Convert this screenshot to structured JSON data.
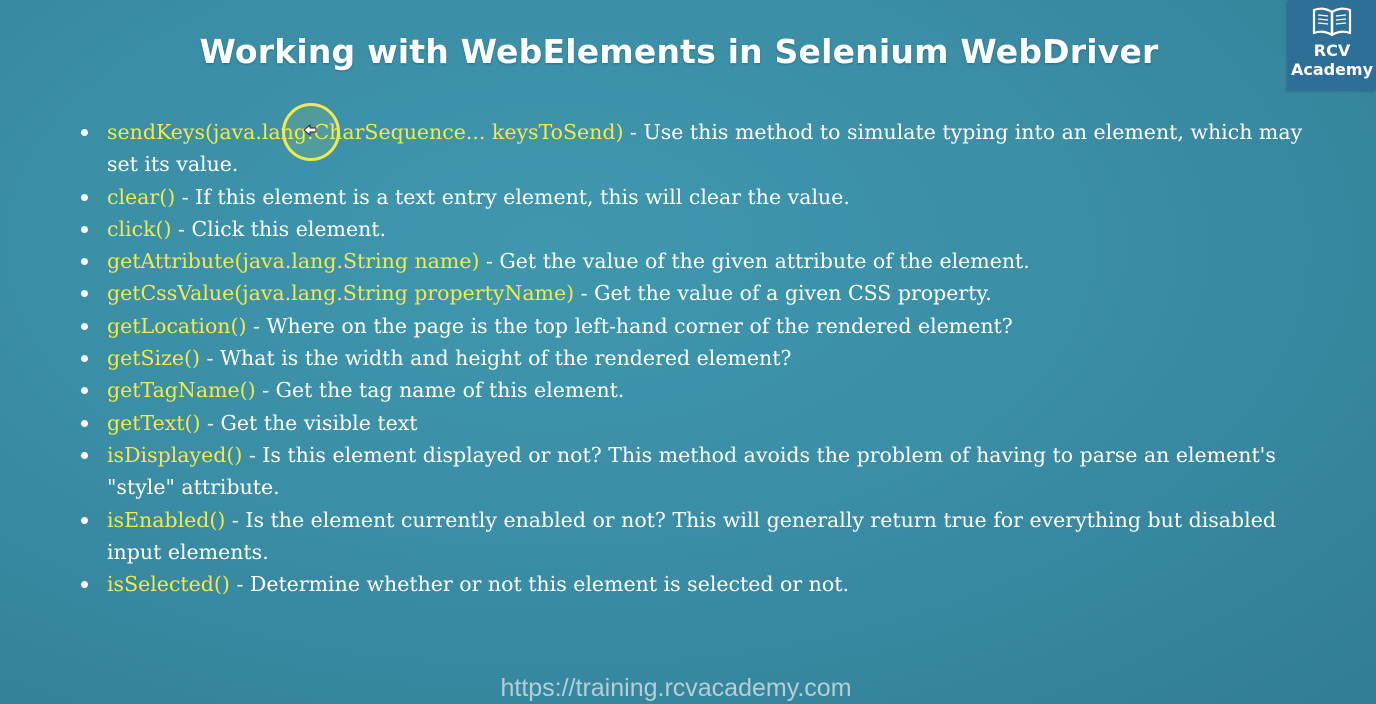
{
  "slide": {
    "title": "Working with WebElements in Selenium WebDriver",
    "footer_url": "https://training.rcvacademy.com"
  },
  "logo": {
    "line1": "RCV",
    "line2": "Academy",
    "icon": "book-icon"
  },
  "colors": {
    "background": "#3a8ea6",
    "method_signature": "#f5e94a",
    "description": "#ffffff",
    "logo_background": "#2e6f97",
    "cursor_highlight": "#f0ea4c"
  },
  "cursor": {
    "icon": "arrow-cursor-icon"
  },
  "methods": [
    {
      "signature": "sendKeys(java.lang.CharSequence... keysToSend)",
      "description": " - Use this method to simulate typing into an element, which may set its value."
    },
    {
      "signature": "clear()",
      "description": " - If this element is a text entry element, this will clear the value."
    },
    {
      "signature": "click()",
      "description": " - Click this element."
    },
    {
      "signature": "getAttribute(java.lang.String name)",
      "description": " - Get the value of the given attribute of the element."
    },
    {
      "signature": "getCssValue(java.lang.String propertyName)",
      "description": " - Get the value of a given CSS property."
    },
    {
      "signature": "getLocation()",
      "description": " - Where on the page is the top left-hand corner of the rendered element?"
    },
    {
      "signature": "getSize()",
      "description": " - What is the width and height of the rendered element?"
    },
    {
      "signature": "getTagName()",
      "description": " - Get the tag name of this element."
    },
    {
      "signature": "getText()",
      "description": " - Get the visible text"
    },
    {
      "signature": "isDisplayed()",
      "description": " - Is this element displayed or not? This method avoids the problem of having to parse an element's \"style\" attribute."
    },
    {
      "signature": "isEnabled()",
      "description": " - Is the element currently enabled or not? This will generally return true for everything but disabled input elements."
    },
    {
      "signature": "isSelected()",
      "description": " - Determine whether or not this element is selected or not."
    }
  ]
}
